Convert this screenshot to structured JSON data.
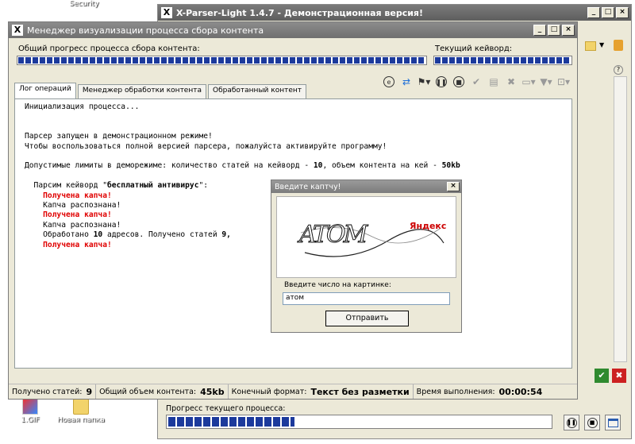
{
  "desktop": {
    "top_icons": [
      "Security"
    ],
    "bottom_icons": [
      "1.GIF",
      "Новая папка"
    ]
  },
  "back_window": {
    "title": "X-Parser-Light 1.4.7 - Демонстрационная версия!",
    "current_progress_label": "Прогресс текущего процесса:"
  },
  "main_window": {
    "title": "Менеджер визуализации процесса сбора контента",
    "overall_progress_label": "Общий прогресс процесса сбора контента:",
    "current_keyword_label": "Текущий кейворд:",
    "tabs": [
      "Лог операций",
      "Менеджер обработки контента",
      "Обработанный контент"
    ],
    "log": {
      "l1": "Инициализация процесса...",
      "l2": "Парсер запущен в демонстрационном режиме!",
      "l3": "Чтобы воспользоваться полной версией парсера, пожалуйста активируйте программу!",
      "l4a": "Допустимые лимиты в деморежиме: количество статей на кейворд - ",
      "l4b": "10",
      "l4c": ", объем контента на кей - ",
      "l4d": "50kb",
      "l5a": "  Парсим кейворд \"",
      "l5b": "бесплатный антивирус",
      "l5c": "\":",
      "l6": "    Получена капча!",
      "l7": "    Капча распознана!",
      "l8": "    Получена капча!",
      "l9": "    Капча распознана!",
      "l10a": "    Обработано ",
      "l10b": "10",
      "l10c": " адресов. Получено статей ",
      "l10d": "9,",
      "l11": "    Получена капча!"
    },
    "status": {
      "articles_label": "Получено статей:",
      "articles_value": "9",
      "volume_label": "Общий объем контента:",
      "volume_value": "45kb",
      "format_label": "Конечный формат:",
      "format_value": "Текст без разметки",
      "time_label": "Время выполнения:",
      "time_value": "00:00:54"
    }
  },
  "captcha_dialog": {
    "title": "Введите каптчу!",
    "image_text": "ATOM",
    "brand": "Яндекс",
    "prompt": "Введите число на картинке:",
    "input_value": "атом",
    "submit_label": "Отправить"
  }
}
